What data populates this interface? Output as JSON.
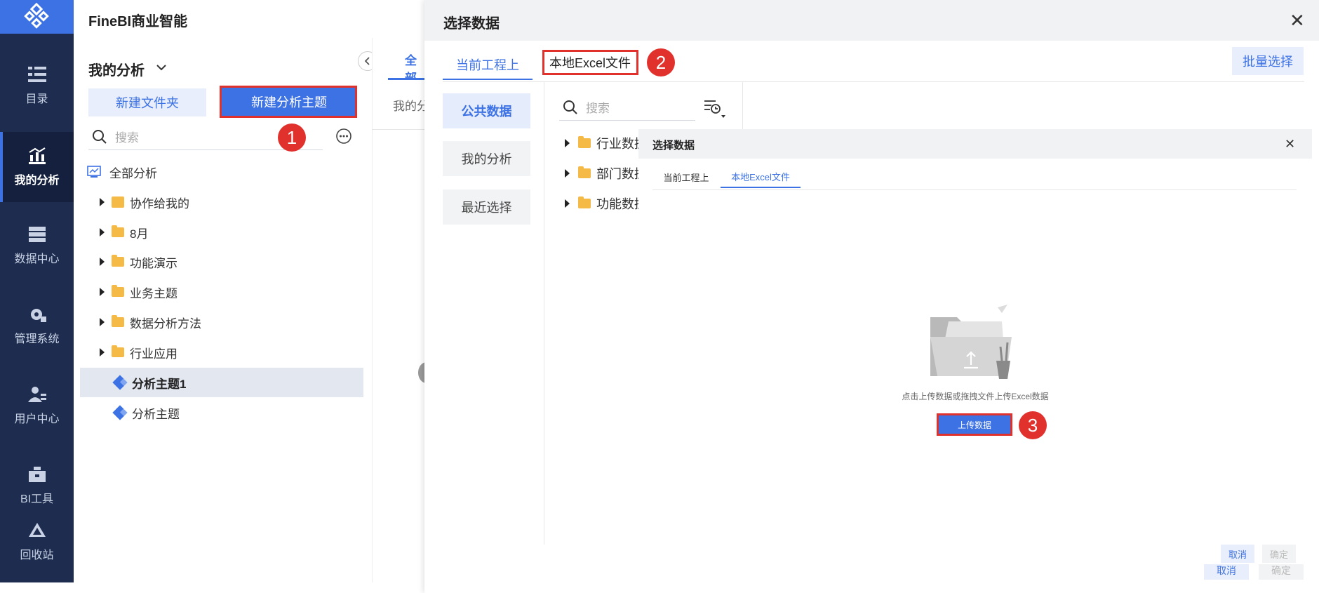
{
  "app": {
    "name": "FineBI商业智能"
  },
  "nav": {
    "items": [
      {
        "label": "目录",
        "icon": "catalog-icon"
      },
      {
        "label": "我的分析",
        "icon": "my-analysis-icon"
      },
      {
        "label": "数据中心",
        "icon": "data-center-icon"
      },
      {
        "label": "管理系统",
        "icon": "gear-icon"
      },
      {
        "label": "用户中心",
        "icon": "user-icon"
      },
      {
        "label": "BI工具",
        "icon": "toolbox-icon"
      },
      {
        "label": "回收站",
        "icon": "recycle-icon"
      }
    ]
  },
  "side": {
    "title": "我的分析",
    "new_folder": "新建文件夹",
    "new_subject": "新建分析主题",
    "search_placeholder": "搜索",
    "root": "全部分析",
    "tree": [
      {
        "label": "协作给我的"
      },
      {
        "label": "8月"
      },
      {
        "label": "功能演示"
      },
      {
        "label": "业务主题"
      },
      {
        "label": "数据分析方法"
      },
      {
        "label": "行业应用"
      },
      {
        "label": "分析主题1"
      },
      {
        "label": "分析主题"
      }
    ]
  },
  "mid": {
    "tab": "全部",
    "crumb": "我的分"
  },
  "dialog": {
    "title": "选择数据",
    "tabs": [
      "当前工程上",
      "本地Excel文件"
    ],
    "batch": "批量选择",
    "categories": [
      "公共数据",
      "我的分析",
      "最近选择"
    ],
    "search_placeholder": "搜索",
    "tree": [
      "行业数据",
      "部门数据",
      "功能数据"
    ],
    "cancel": "取消",
    "confirm": "确定"
  },
  "inner": {
    "title": "选择数据",
    "tabs": [
      "当前工程上",
      "本地Excel文件"
    ],
    "hint": "点击上传数据或拖拽文件上传Excel数据",
    "upload": "上传数据",
    "cancel": "取消",
    "confirm": "确定"
  },
  "annotations": [
    "1",
    "2",
    "3"
  ],
  "colors": {
    "nav_bg": "#1e2d4f",
    "accent": "#3d72e4",
    "marker": "#e0312c"
  }
}
